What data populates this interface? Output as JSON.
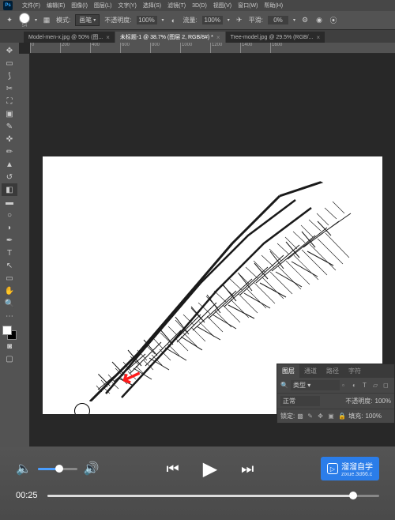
{
  "menubar": {
    "items": [
      "文件(F)",
      "编辑(E)",
      "图像(I)",
      "图层(L)",
      "文字(Y)",
      "选择(S)",
      "滤镜(T)",
      "3D(D)",
      "视图(V)",
      "窗口(W)",
      "帮助(H)"
    ]
  },
  "optbar": {
    "size": "54",
    "mode_label": "模式:",
    "mode_value": "画笔",
    "opacity_label": "不透明度:",
    "opacity_value": "100%",
    "flow_label": "流量:",
    "flow_value": "100%",
    "smooth_label": "平滑:",
    "smooth_value": "0%"
  },
  "tabs": [
    {
      "label": "Model-men-x.jpg @ 50% (图...",
      "active": false
    },
    {
      "label": "未标题-1 @ 38.7% (图层 2, RGB/8#) *",
      "active": true
    },
    {
      "label": "Tree-model.jpg @ 29.5% (RGB/...",
      "active": false
    }
  ],
  "ruler": {
    "marks": [
      "0",
      "200",
      "400",
      "600",
      "800",
      "1000",
      "1200",
      "1400",
      "1600"
    ]
  },
  "panels": {
    "tabs": [
      "图层",
      "通道",
      "路径",
      "字符"
    ],
    "type_label": "类型",
    "blend": "正常",
    "opacity_label": "不透明度:",
    "opacity_value": "100%",
    "lock_label": "锁定:",
    "fill_label": "填充:",
    "fill_value": "100%"
  },
  "video": {
    "time": "00:25",
    "brand": "溜溜自学",
    "brand_sub": "zixue.3d66.c"
  }
}
